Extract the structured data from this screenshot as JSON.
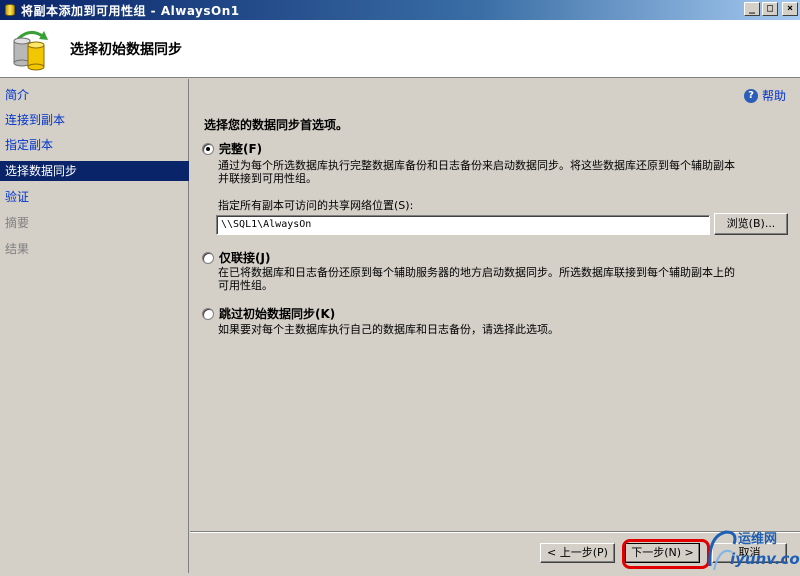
{
  "window": {
    "title": "将副本添加到可用性组 - AlwaysOn1",
    "controls": {
      "minimize": "_",
      "restore": "□",
      "close": "×"
    }
  },
  "header": {
    "title": "选择初始数据同步"
  },
  "sidebar": {
    "items": [
      {
        "label": "简介",
        "state": "link"
      },
      {
        "label": "连接到副本",
        "state": "link"
      },
      {
        "label": "指定副本",
        "state": "link"
      },
      {
        "label": "选择数据同步",
        "state": "active"
      },
      {
        "label": "验证",
        "state": "link"
      },
      {
        "label": "摘要",
        "state": "disabled"
      },
      {
        "label": "结果",
        "state": "disabled"
      }
    ]
  },
  "main": {
    "help_label": "帮助",
    "prompt": "选择您的数据同步首选项。",
    "options": [
      {
        "label": "完整(F)",
        "checked": true,
        "description": [
          "通过为每个所选数据库执行完整数据库备份和日志备份来启动数据同步。将这些数据库还原到每个辅助副本",
          "并联接到可用性组。"
        ]
      },
      {
        "label": "仅联接(J)",
        "checked": false,
        "description": [
          "在已将数据库和日志备份还原到每个辅助服务器的地方启动数据同步。所选数据库联接到每个辅助副本上的",
          "可用性组。"
        ]
      },
      {
        "label": "跳过初始数据同步(K)",
        "checked": false,
        "description": [
          "如果要对每个主数据库执行自己的数据库和日志备份，请选择此选项。"
        ]
      }
    ],
    "share_label": "指定所有副本可访问的共享网络位置(S):",
    "share_value": "\\\\SQL1\\AlwaysOn",
    "browse_label": "浏览(B)..."
  },
  "footer": {
    "prev_label": "< 上一步(P)",
    "next_label": "下一步(N) >",
    "cancel_label": "取消"
  },
  "watermark": {
    "top": "运维网",
    "bottom": "iyunv.com"
  },
  "colors": {
    "title_bar": "#0a246a",
    "selected": "#0a246a",
    "link": "#0033cc",
    "highlight": "#e00000"
  }
}
